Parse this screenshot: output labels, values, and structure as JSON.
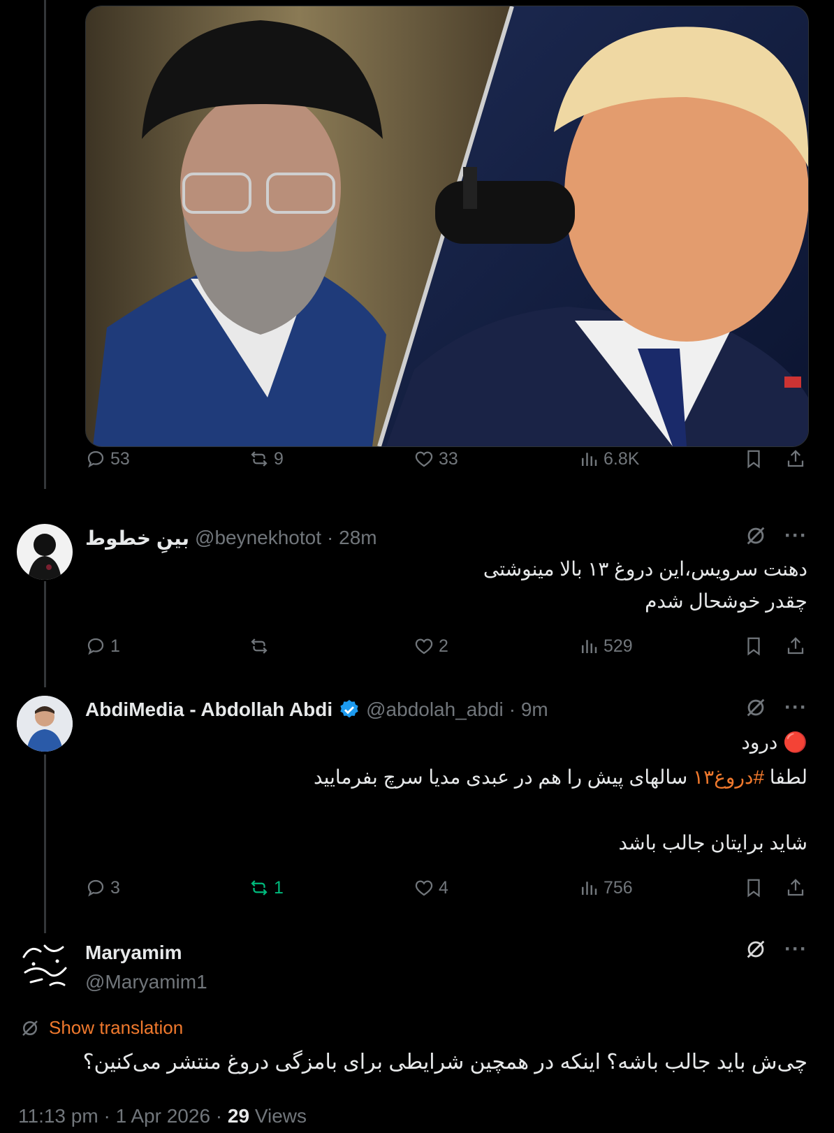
{
  "main_post": {
    "stats": {
      "replies": "53",
      "reposts": "9",
      "likes": "33",
      "views": "6.8K"
    }
  },
  "replies": [
    {
      "name": "بینِ خطوط",
      "handle": "@beynekhotot",
      "time": "· 28m",
      "lines": [
        "دهنت سرویس،این دروغ ۱۳ بالا مینوشتی",
        "چقدر خوشحال شدم"
      ],
      "stats": {
        "replies": "1",
        "reposts": "",
        "likes": "2",
        "views": "529"
      }
    },
    {
      "name": "AbdiMedia - Abdollah Abdi",
      "handle": "@abdolah_abdi",
      "time": "· 9m",
      "greeting_emoji": "🔴",
      "greeting": "درود",
      "line2_before": "لطفا",
      "hashtag": "#دروغ۱۳",
      "line2_after": "سالهای پیش را هم در عبدی مدیا سرچ بفرمایید",
      "line3": "شاید برایتان جالب باشد",
      "stats": {
        "replies": "3",
        "reposts": "1",
        "likes": "4",
        "views": "756"
      }
    }
  ],
  "focused_post": {
    "name": "Maryamim",
    "handle": "@Maryamim1",
    "avatar_text": "زن زندگی آزادی",
    "show_translation": "Show translation",
    "text": "چی‌ش باید جالب باشه؟ اینکه در همچین شرایطی برای بامزگی دروغ منتشر می‌کنین؟",
    "time": "11:13 pm",
    "date": "1 Apr 2026",
    "views_count": "29",
    "views_label": "Views"
  },
  "more_label": "···",
  "colors": {
    "accent": "#f0792d",
    "verified": "#1d9bf0",
    "repost_active": "#00ba7c",
    "muted": "#71767b"
  },
  "icons": [
    "reply-icon",
    "repost-icon",
    "like-icon",
    "views-icon",
    "bookmark-icon",
    "share-icon",
    "grok-icon",
    "verified-badge-icon",
    "translate-icon"
  ]
}
